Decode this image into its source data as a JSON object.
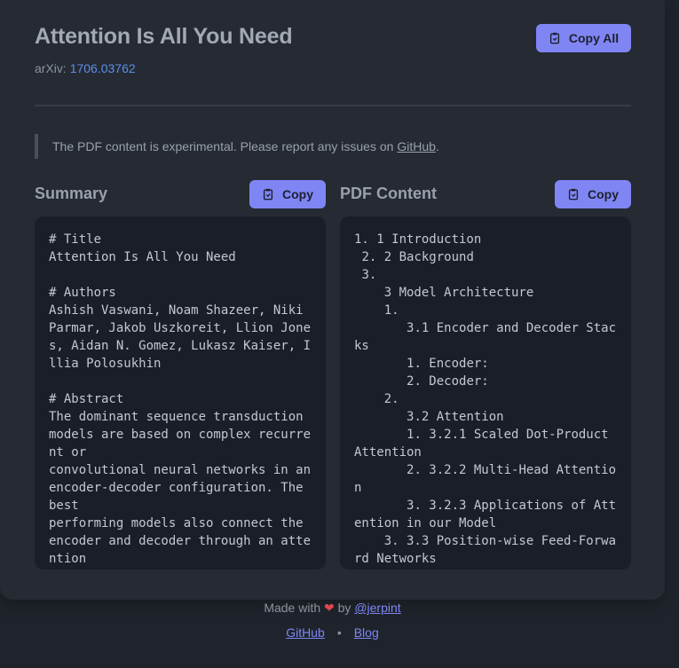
{
  "header": {
    "title": "Attention Is All You Need",
    "arxiv_label": "arXiv:",
    "arxiv_id": "1706.03762",
    "copy_all_label": "Copy All"
  },
  "notice": {
    "text": "The PDF content is experimental. Please report any issues on ",
    "link": "GitHub",
    "end": "."
  },
  "summary": {
    "title": "Summary",
    "copy_label": "Copy",
    "content": "# Title\nAttention Is All You Need\n\n# Authors\nAshish Vaswani, Noam Shazeer, Niki Parmar, Jakob Uszkoreit, Llion Jones, Aidan N. Gomez, Lukasz Kaiser, Illia Polosukhin\n\n# Abstract\nThe dominant sequence transduction models are based on complex recurrent or\nconvolutional neural networks in an encoder-decoder configuration. The best\nperforming models also connect the encoder and decoder through an attention"
  },
  "pdf": {
    "title": "PDF Content",
    "copy_label": "Copy",
    "content": "1. 1 Introduction\n 2. 2 Background\n 3.\n    3 Model Architecture\n    1.\n       3.1 Encoder and Decoder Stacks\n       1. Encoder:\n       2. Decoder:\n    2.\n       3.2 Attention\n       1. 3.2.1 Scaled Dot-Product Attention\n       2. 3.2.2 Multi-Head Attention\n       3. 3.2.3 Applications of Attention in our Model\n    3. 3.3 Position-wise Feed-Forward Networks"
  },
  "footer": {
    "made_with": "Made with",
    "heart": "❤",
    "by": "by",
    "author": "@jerpint",
    "github": "GitHub",
    "separator": "•",
    "blog": "Blog"
  },
  "colors": {
    "background": "#1f242c",
    "card": "#252a33",
    "accent": "#7f86f3",
    "link": "#5b8fe8",
    "heart": "#e0474c"
  }
}
